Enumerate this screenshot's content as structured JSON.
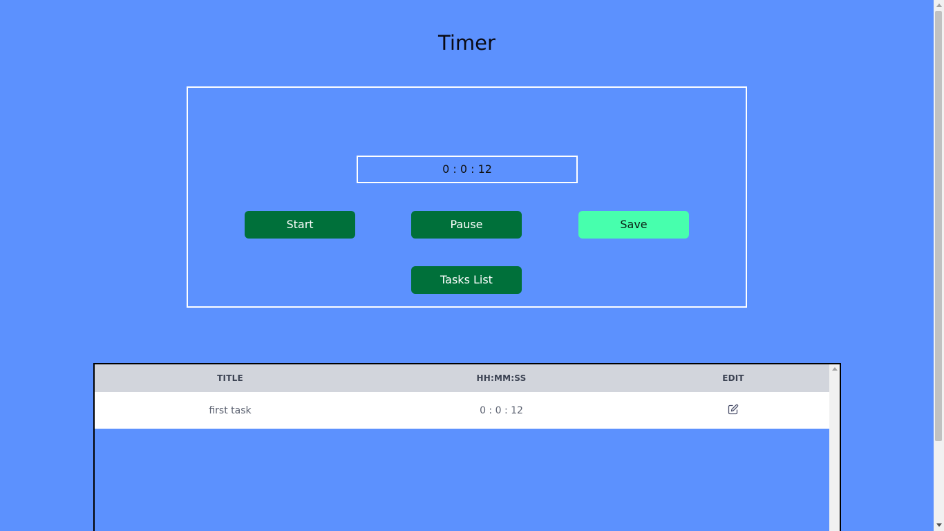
{
  "header": {
    "title": "Timer"
  },
  "timer": {
    "display": "0 : 0 : 12",
    "start_label": "Start",
    "pause_label": "Pause",
    "save_label": "Save",
    "tasks_list_label": "Tasks List"
  },
  "tasks_table": {
    "columns": [
      "TITLE",
      "HH:MM:SS",
      "EDIT"
    ],
    "rows": [
      {
        "title": "first task",
        "time": "0 : 0 : 12",
        "edit_icon": "edit-icon"
      }
    ]
  },
  "colors": {
    "background": "#5c91fe",
    "primary_button": "#00703a",
    "save_button": "#47ffad",
    "table_header": "#d2d5dc"
  }
}
